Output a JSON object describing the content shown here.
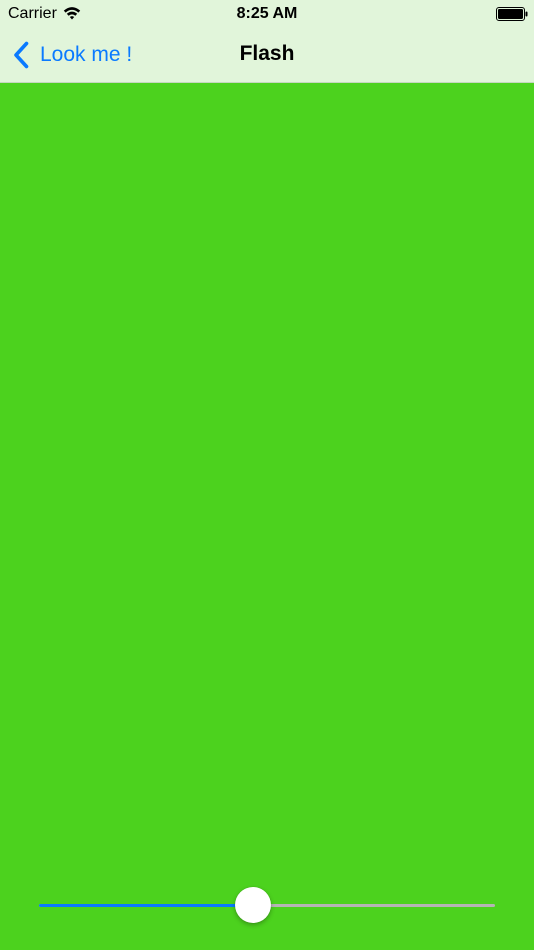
{
  "colors": {
    "header_bg": "#e1f5da",
    "content_bg": "#4cd21e",
    "accent": "#0a7aff",
    "slider_track": "#b5b5b5",
    "slider_fill": "#0a7aff"
  },
  "status_bar": {
    "carrier": "Carrier",
    "wifi_icon": "wifi-icon",
    "time": "8:25 AM",
    "battery_icon": "battery-icon"
  },
  "nav_bar": {
    "back_icon": "chevron-left-icon",
    "back_label": "Look me !",
    "title": "Flash"
  },
  "slider": {
    "value": 0.47
  }
}
